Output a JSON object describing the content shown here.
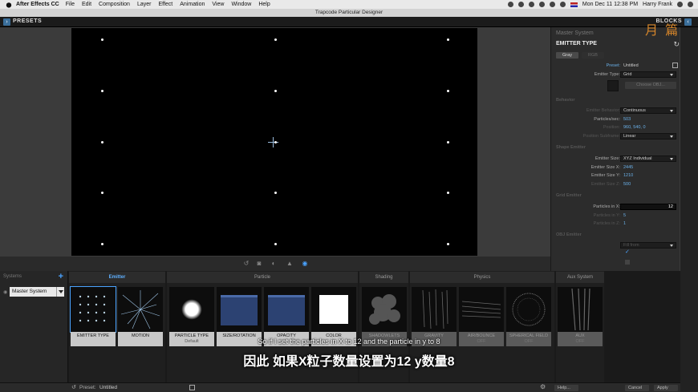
{
  "menubar": {
    "app": "After Effects CC",
    "items": [
      "File",
      "Edit",
      "Composition",
      "Layer",
      "Effect",
      "Animation",
      "View",
      "Window",
      "Help"
    ],
    "datetime": "Mon Dec 11  12:38 PM",
    "user": "Harry Frank"
  },
  "window": {
    "title": "Trapcode Particular Designer"
  },
  "topbar": {
    "presets_label": "PRESETS",
    "blocks_label": "BLOCKS"
  },
  "panel": {
    "master": "Master System",
    "title": "EMITTER TYPE",
    "tabs": [
      "Gray",
      "RGB"
    ],
    "preset_label": "Preset:",
    "preset_value": "Untitled",
    "emitter_type_label": "Emitter Type:",
    "emitter_type_value": "Grid",
    "choose_obj": "Choose OBJ...",
    "behavior_section": "Behavior",
    "emitter_behavior_label": "Emitter Behavior:",
    "emitter_behavior_value": "Continuous",
    "particles_sec_label": "Particles/sec:",
    "particles_sec_value": "503",
    "position_label": "Position:",
    "position_value": "960, 540, 0",
    "position_subframe_label": "Position Subframe:",
    "position_subframe_value": "Linear",
    "shape_section": "Shape Emitter",
    "emitter_size_label": "Emitter Size:",
    "emitter_size_value": "XYZ Individual",
    "size_x_label": "Emitter Size X:",
    "size_x_value": "2445",
    "size_y_label": "Emitter Size Y:",
    "size_y_value": "1210",
    "size_z_label": "Emitter Size Z:",
    "size_z_value": "500",
    "grid_section": "Grid Emitter",
    "px_label": "Particles in X:",
    "px_value": "12",
    "py_label": "Particles in Y:",
    "py_value": "5",
    "pz_label": "Particles in Z:",
    "pz_value": "1",
    "obj_section": "OBJ Emitter",
    "obj_dd_value": "Fill from"
  },
  "viewer": {
    "grid_cols": 3,
    "grid_rows": 5
  },
  "systems": {
    "label": "Systems",
    "add": "+",
    "current": "Master System"
  },
  "blocks": {
    "emitter": {
      "header": "Emitter",
      "tiles": [
        {
          "label": "EMITTER TYPE"
        },
        {
          "label": "MOTION"
        }
      ]
    },
    "particle": {
      "header": "Particle",
      "tiles": [
        {
          "label": "PARTICLE TYPE",
          "sub": "Default"
        },
        {
          "label": "SIZE/ROTATION"
        },
        {
          "label": "OPACITY"
        },
        {
          "label": "COLOR"
        }
      ]
    },
    "shading": {
      "header": "Shading",
      "tiles": [
        {
          "label": "SHADOWLETS",
          "sub": "OFF"
        }
      ]
    },
    "physics": {
      "header": "Physics",
      "tiles": [
        {
          "label": "GRAVITY",
          "sub": "OFF"
        },
        {
          "label": "AIR/BOUNCE",
          "sub": "OFF"
        },
        {
          "label": "SPHERICAL FIELD",
          "sub": "OFF"
        }
      ]
    },
    "aux": {
      "header": "Aux System",
      "tiles": [
        {
          "label": "AUX",
          "sub": "OFF"
        }
      ]
    }
  },
  "status": {
    "preset_label": "Preset:",
    "preset_value": "Untitled",
    "help": "Help...",
    "cancel": "Cancel",
    "apply": "Apply"
  },
  "subtitles": {
    "en": "So if I set the particles in X to 12 and the particle in y to 8",
    "zh": "因此 如果X粒子数量设置为12 y数量8"
  },
  "watermark": "月 篇",
  "accent_color": "#4aa3ff"
}
